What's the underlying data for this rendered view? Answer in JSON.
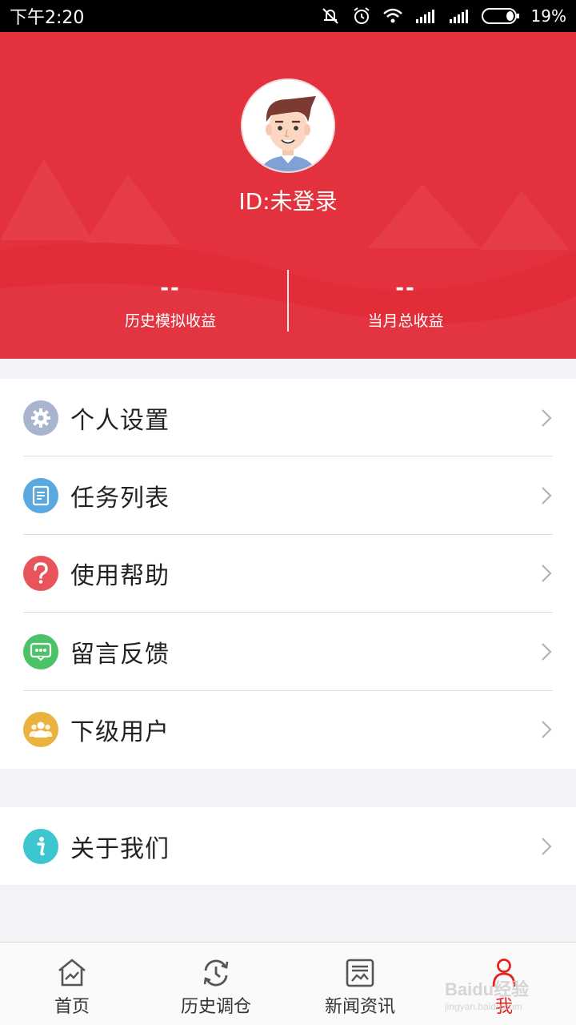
{
  "status_bar": {
    "time": "下午2:20",
    "battery": "19%"
  },
  "profile": {
    "id_text": "ID:未登录"
  },
  "stats": [
    {
      "value": "--",
      "label": "历史模拟收益"
    },
    {
      "value": "--",
      "label": "当月总收益"
    }
  ],
  "menu": {
    "items": [
      {
        "label": "个人设置",
        "icon": "gear-icon",
        "color": "#a9b4cf"
      },
      {
        "label": "任务列表",
        "icon": "document-icon",
        "color": "#59a9e0"
      },
      {
        "label": "使用帮助",
        "icon": "question-icon",
        "color": "#e9535c"
      },
      {
        "label": "留言反馈",
        "icon": "chat-bubble-icon",
        "color": "#4cc267"
      },
      {
        "label": "下级用户",
        "icon": "group-icon",
        "color": "#eab340"
      }
    ],
    "about": {
      "label": "关于我们",
      "icon": "info-icon",
      "color": "#3ec6d0"
    }
  },
  "tabbar": {
    "tabs": [
      {
        "label": "首页",
        "icon": "home-chart-icon"
      },
      {
        "label": "历史调仓",
        "icon": "history-refresh-icon"
      },
      {
        "label": "新闻资讯",
        "icon": "news-icon"
      },
      {
        "label": "我",
        "icon": "person-icon",
        "active": true
      }
    ]
  },
  "colors": {
    "brand_red": "#e3323e",
    "active_tab": "#e3231e"
  },
  "watermark": {
    "text": "Baidu经验",
    "sub": "jingyan.baidu.com"
  }
}
